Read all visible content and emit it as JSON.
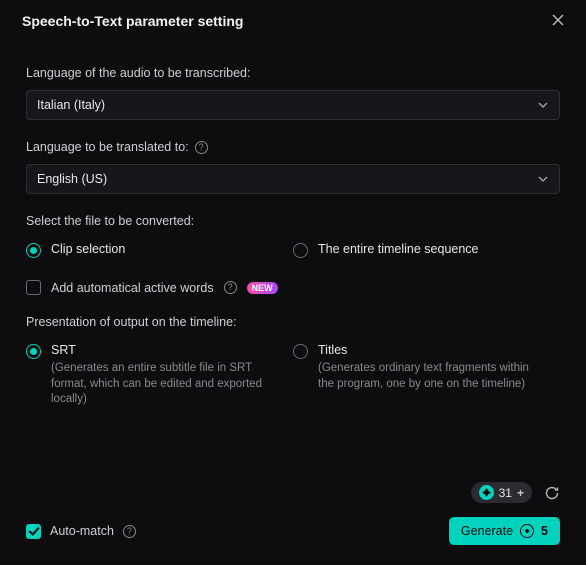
{
  "header": {
    "title": "Speech-to-Text parameter setting"
  },
  "source_lang": {
    "label": "Language of the audio to be transcribed:",
    "value": "Italian (Italy)"
  },
  "target_lang": {
    "label": "Language to be translated to:",
    "value": "English (US)"
  },
  "file_select": {
    "label": "Select the file to be converted:",
    "options": {
      "clip": "Clip selection",
      "timeline": "The entire timeline sequence"
    }
  },
  "active_words": {
    "label": "Add automatical active words",
    "badge": "NEW"
  },
  "presentation": {
    "label": "Presentation of output on the timeline:",
    "srt": {
      "label": "SRT",
      "desc": "(Generates an entire subtitle file in SRT format, which can be edited and exported locally)"
    },
    "titles": {
      "label": "Titles",
      "desc": "(Generates ordinary text fragments within the program, one by one on the timeline)"
    }
  },
  "footer": {
    "credits": "31",
    "auto_match": "Auto-match",
    "generate": "Generate",
    "cost": "5"
  }
}
